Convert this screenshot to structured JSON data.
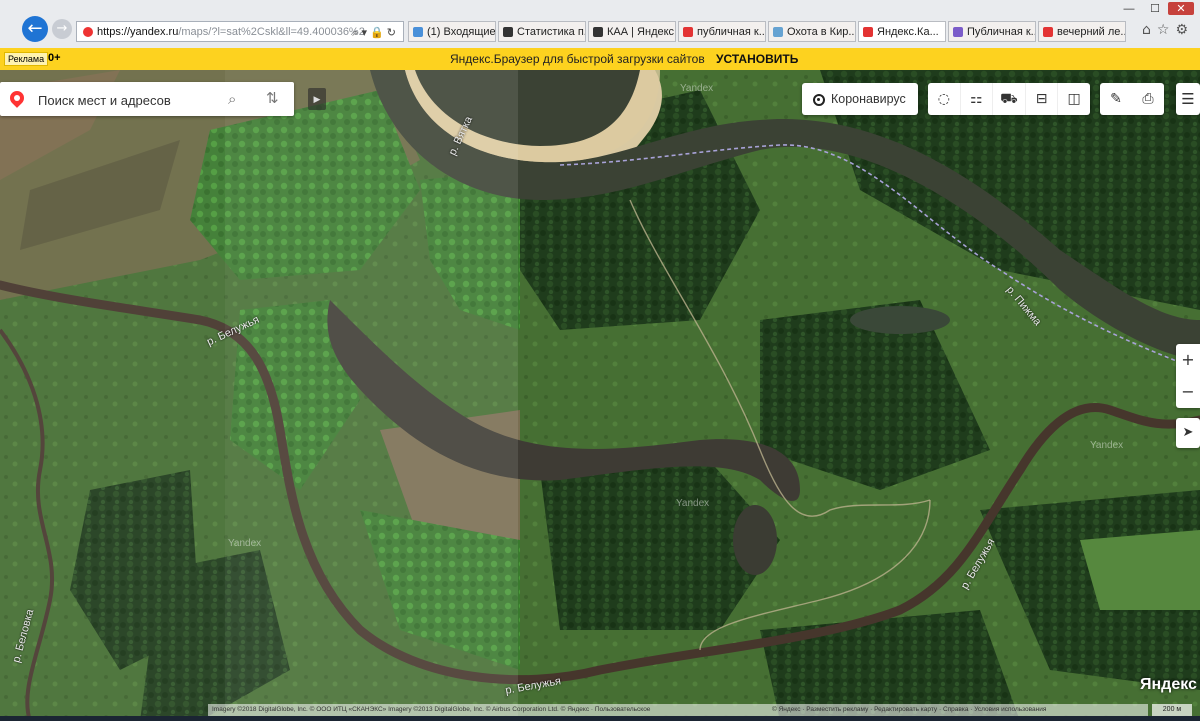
{
  "browser": {
    "url_host": "https://yandex.ru",
    "url_rest": "/maps/?l=sat%2Cskl&ll=49.400036%2",
    "tabs": [
      {
        "label": "(1) Входящие...",
        "icon_color": "#4a90d9",
        "active": false
      },
      {
        "label": "Статистика п...",
        "icon_color": "#333333",
        "active": false
      },
      {
        "label": "КАА | Яндекс...",
        "icon_color": "#333333",
        "active": false
      },
      {
        "label": "публичная к...",
        "icon_color": "#e33333",
        "active": false
      },
      {
        "label": "Охота в Кир...",
        "icon_color": "#66a3d2",
        "active": false
      },
      {
        "label": "Яндекс.Ка...",
        "icon_color": "#e33333",
        "active": true
      },
      {
        "label": "Публичная к...",
        "icon_color": "#7b5cc9",
        "active": false
      },
      {
        "label": "вечерний ле...",
        "icon_color": "#e33333",
        "active": false
      }
    ]
  },
  "promo": {
    "ad_label": "Реклама",
    "age_label": "0+",
    "text": "Яндекс.Браузер для быстрой загрузки сайтов",
    "install_label": "УСТАНОВИТЬ"
  },
  "search": {
    "placeholder": "Поиск мест и адресов"
  },
  "map_controls": {
    "corona_label": "Коронавирус"
  },
  "map_labels": {
    "vyatka": "р. Вятка",
    "beluzhaya_1": "р. Белужья",
    "pizhma": "р. Пижма",
    "beluzhaya_2": "р. Белужья",
    "beluzhaya_3": "р. Белужья",
    "belovka": "р. Беловка"
  },
  "watermarks": [
    "Yandex",
    "Yandex",
    "Yandex",
    "Yandex"
  ],
  "footer": {
    "logo": "Яндекс",
    "copyright": "Imagery ©2018 DigitalGlobe, Inc. © ООО ИТЦ «СКАНЭКС» Imagery ©2013 DigitalGlobe, Inc. © Airbus Corporation Ltd. © Яндекс · Пользовательское",
    "terms": "© Яндекс · Разместить рекламу · Редактировать карту · Справка · Условия использования",
    "scale": "200 м"
  },
  "colors": {
    "promo_bg": "#fdd21f",
    "river": "#4a3a32",
    "forest": "#1f3c1c",
    "meadow": "#3f6a2e"
  }
}
